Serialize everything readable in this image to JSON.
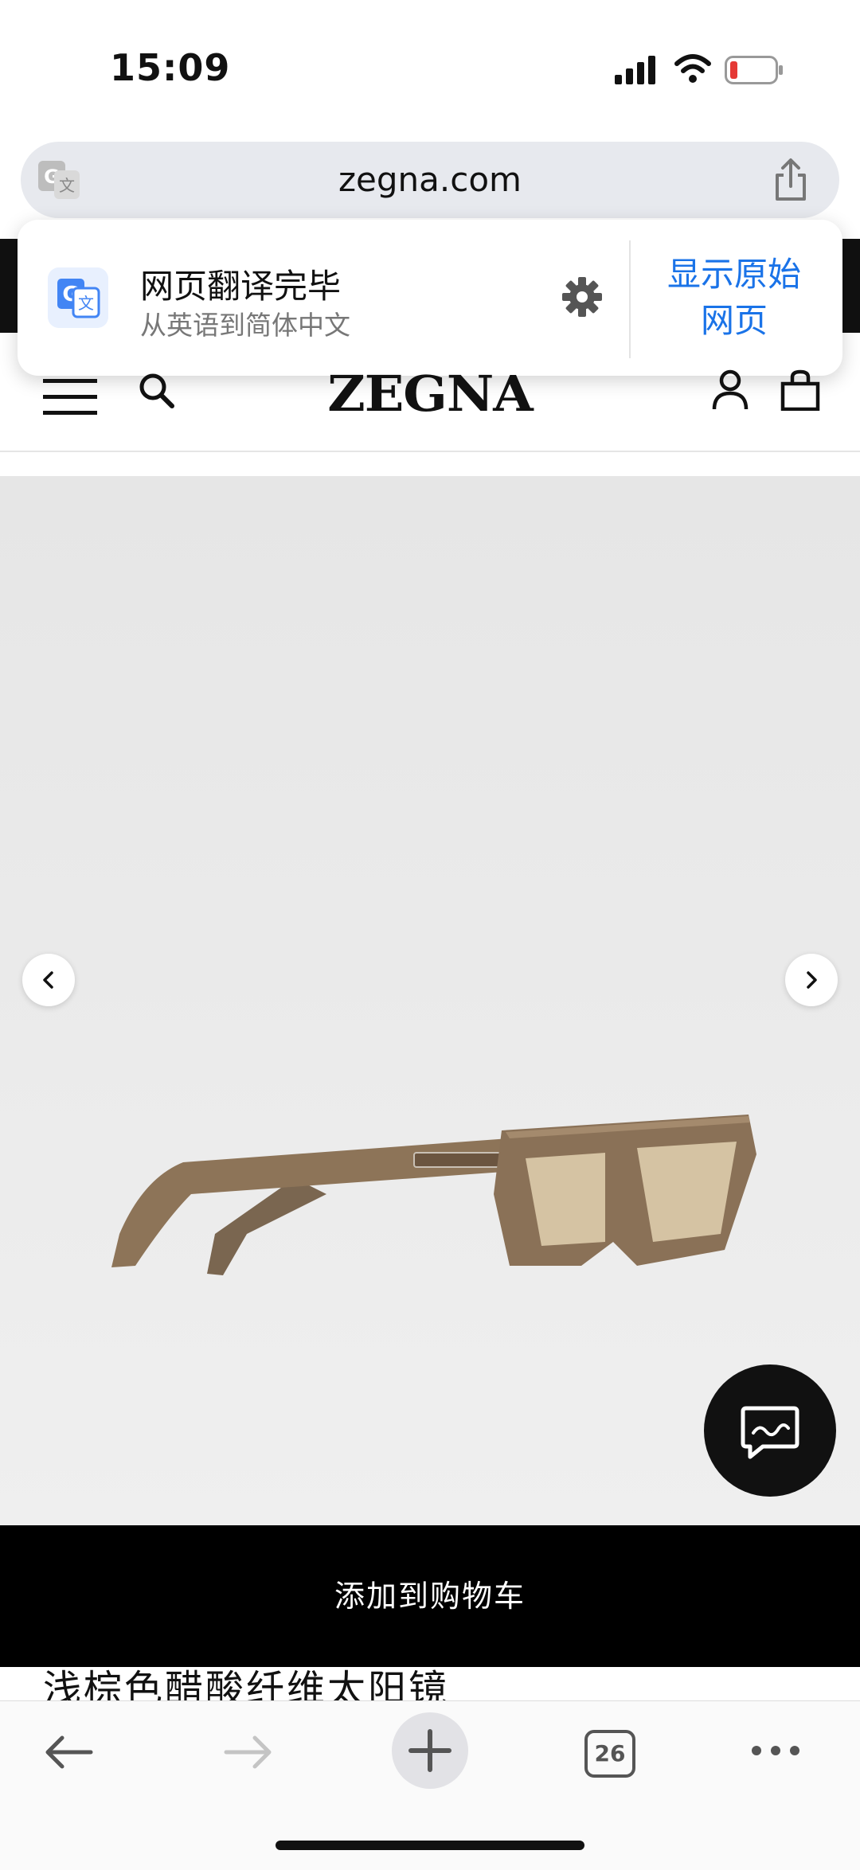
{
  "status_bar": {
    "time": "15:09"
  },
  "url_bar": {
    "url": "zegna.com"
  },
  "translate_popover": {
    "title": "网页翻译完毕",
    "subtitle": "从英语到简体中文",
    "show_original_line1": "显示原始",
    "show_original_line2": "网页"
  },
  "site_header": {
    "logo": "ZEGNA"
  },
  "product": {
    "add_to_cart": "添加到购物车",
    "title": "浅棕色醋酸纤维太阳镜"
  },
  "toolbar": {
    "tab_count": "26"
  },
  "colors": {
    "accent_blue": "#1a73e8",
    "frame_brown": "#8d7458",
    "lens_tint": "#d9c7a8"
  }
}
